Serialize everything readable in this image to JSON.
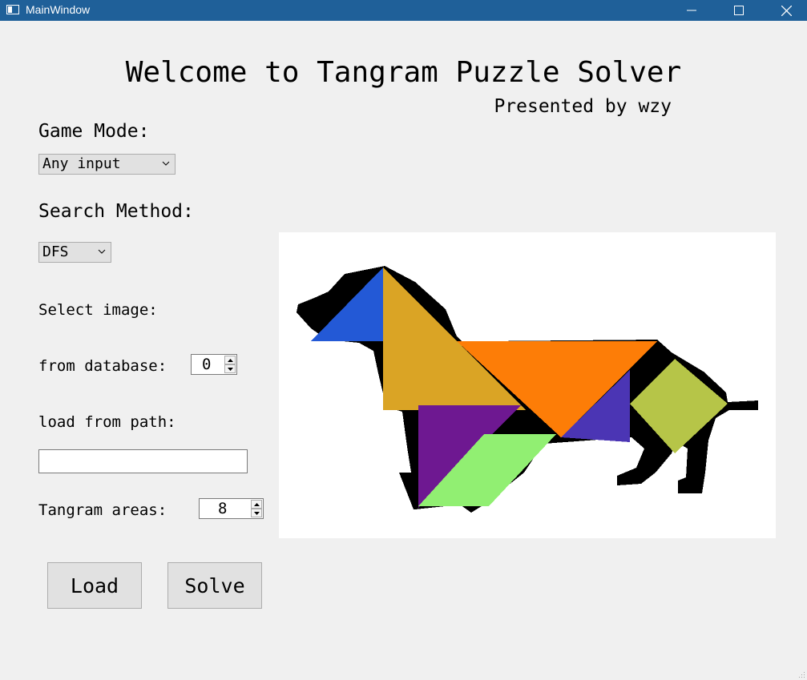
{
  "window": {
    "title": "MainWindow",
    "controls": [
      "minimize-icon",
      "maximize-icon",
      "close-icon"
    ]
  },
  "header": {
    "title": "Welcome to Tangram Puzzle Solver",
    "subtitle": "Presented by wzy"
  },
  "form": {
    "game_mode_label": "Game Mode:",
    "game_mode_value": "Any input",
    "search_method_label": "Search Method:",
    "search_method_value": "DFS",
    "select_image_label": "Select image:",
    "from_database_label": "from database:",
    "from_database_value": "0",
    "load_from_path_label": "load from path:",
    "load_from_path_value": "",
    "tangram_areas_label": "Tangram areas:",
    "tangram_areas_value": "8"
  },
  "buttons": {
    "load_label": "Load",
    "solve_label": "Solve"
  },
  "canvas": {
    "subject": "dog silhouette tangram solution",
    "colors": {
      "silhouette": "#000000",
      "small_triangle": "#2359d6",
      "large_triangle_left": "#daa425",
      "large_triangle_top": "#fd7d07",
      "medium_triangle": "#4b35b4",
      "square": "#b6c548",
      "small_triangle_purple": "#6e1891",
      "parallelogram": "#91ef72"
    }
  },
  "theme": {
    "titlebar": "#1f6099",
    "window_bg": "#f0f0f0"
  }
}
